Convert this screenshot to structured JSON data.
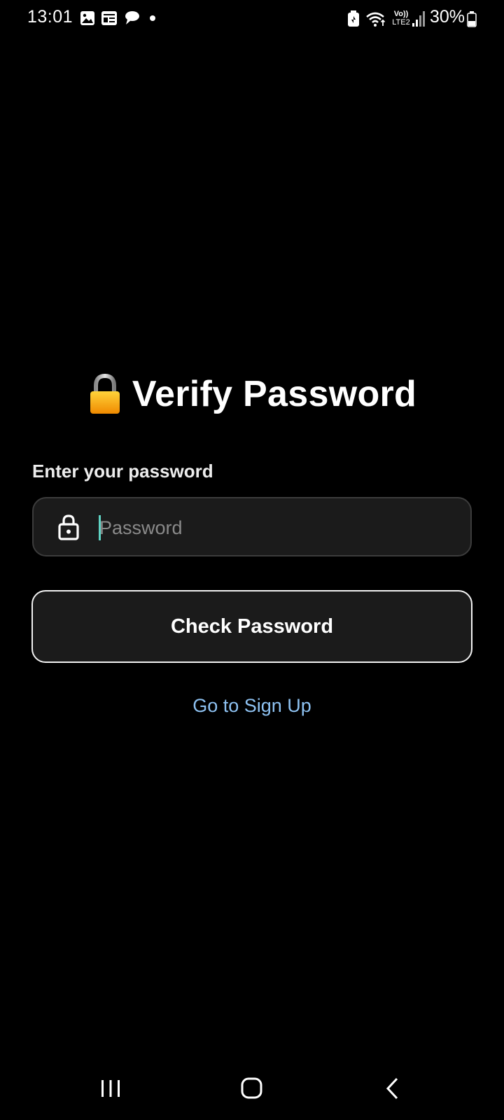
{
  "status_bar": {
    "time": "13:01",
    "battery_text": "30%",
    "network_label_top": "Vo))",
    "network_label_bottom": "LTE2",
    "notification_icons": [
      "gallery-icon",
      "news-icon",
      "chat-bubbles-icon",
      "more-dot-icon"
    ],
    "system_icons": [
      "battery-saver-icon",
      "wifi-icon",
      "volte-lte-icon",
      "signal-icon",
      "battery-icon"
    ]
  },
  "screen": {
    "title_emoji": "🔒",
    "title": "Verify Password",
    "field_label": "Enter your password",
    "password": {
      "value": "",
      "placeholder": "Password",
      "icon": "lock-icon"
    },
    "check_button_label": "Check Password",
    "signup_link_label": "Go to Sign Up"
  },
  "nav_bar": {
    "buttons": [
      "recent-apps-icon",
      "home-icon",
      "back-icon"
    ]
  },
  "colors": {
    "background": "#000000",
    "field_background": "#1b1b1b",
    "field_border": "#3c3c3c",
    "button_border": "#f2f2f2",
    "link": "#8ec2f2",
    "cursor": "#5fd4c4",
    "placeholder": "#8a8a8a"
  }
}
